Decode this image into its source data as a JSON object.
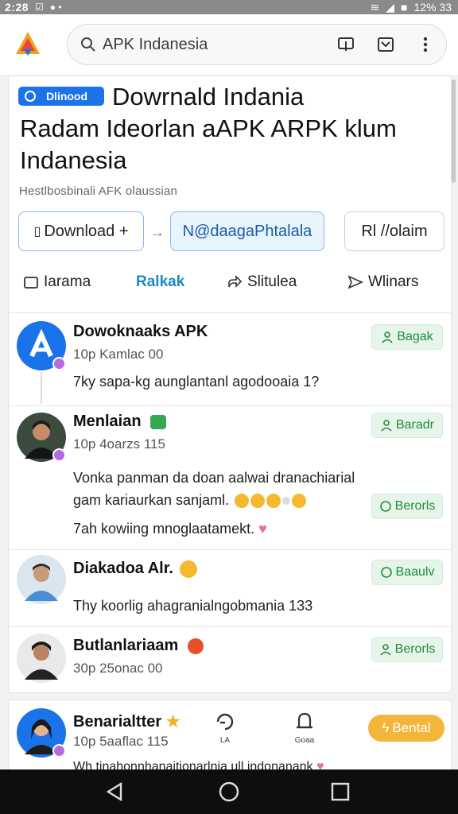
{
  "status_bar": {
    "time": "2:28",
    "battery": "12% 33"
  },
  "browser": {
    "url_text": "APK Indanesia"
  },
  "header": {
    "badge_label": "Dlinood",
    "title_line1": "Dowrnald Indania",
    "title_line2": "Radam Ideorlan aAPK ARPK klum",
    "title_line3": "Indanesia",
    "subtitle": "Hestlbosbinali AFK olaussian"
  },
  "actions": {
    "download_label": "Download +",
    "secondary_label": "N@daagaPhtalala",
    "third_label": "Rl //olaim"
  },
  "tabs": [
    {
      "label": "Iarama"
    },
    {
      "label": "Ralkak"
    },
    {
      "label": "Slitulea"
    },
    {
      "label": "Wlinars"
    }
  ],
  "posts": [
    {
      "name": "Dowoknaaks APK",
      "meta": "10p Kamlac 00",
      "text": "7ky sapa-kg aunglantanl agodooaia 1?",
      "follow_label": "Bagak"
    },
    {
      "name": "Menlaian",
      "meta": "10p 4oarzs 115",
      "text_line1": "Vonka panman da doan aalwai dranachiarial",
      "text_line2": "gam kariaurkan sanjaml.",
      "text_line3": "7ah kowiing mnoglaatamekt.",
      "follow_label": "Baradr"
    },
    {
      "name": "Diakadoa Alr.",
      "meta": "",
      "text": "Thy koorlig ahagranialngobmania 133",
      "follow_label": "Baaulv"
    },
    {
      "name": "Butlanlariaam",
      "meta": "30p 25onac 00",
      "text": "",
      "follow_label": "Berorls"
    }
  ],
  "next_post": {
    "name": "Benarialtter",
    "meta": "10p 5aaflac 115",
    "text": "Wh tinahonnhanaitionarlnia ull indonanank",
    "mini1": "LA",
    "mini2": "Goaa",
    "action_label": "Bental"
  },
  "colors": {
    "accent": "#1a73e8",
    "follow_green": "#1e8e3e",
    "orange": "#f4b53b"
  }
}
